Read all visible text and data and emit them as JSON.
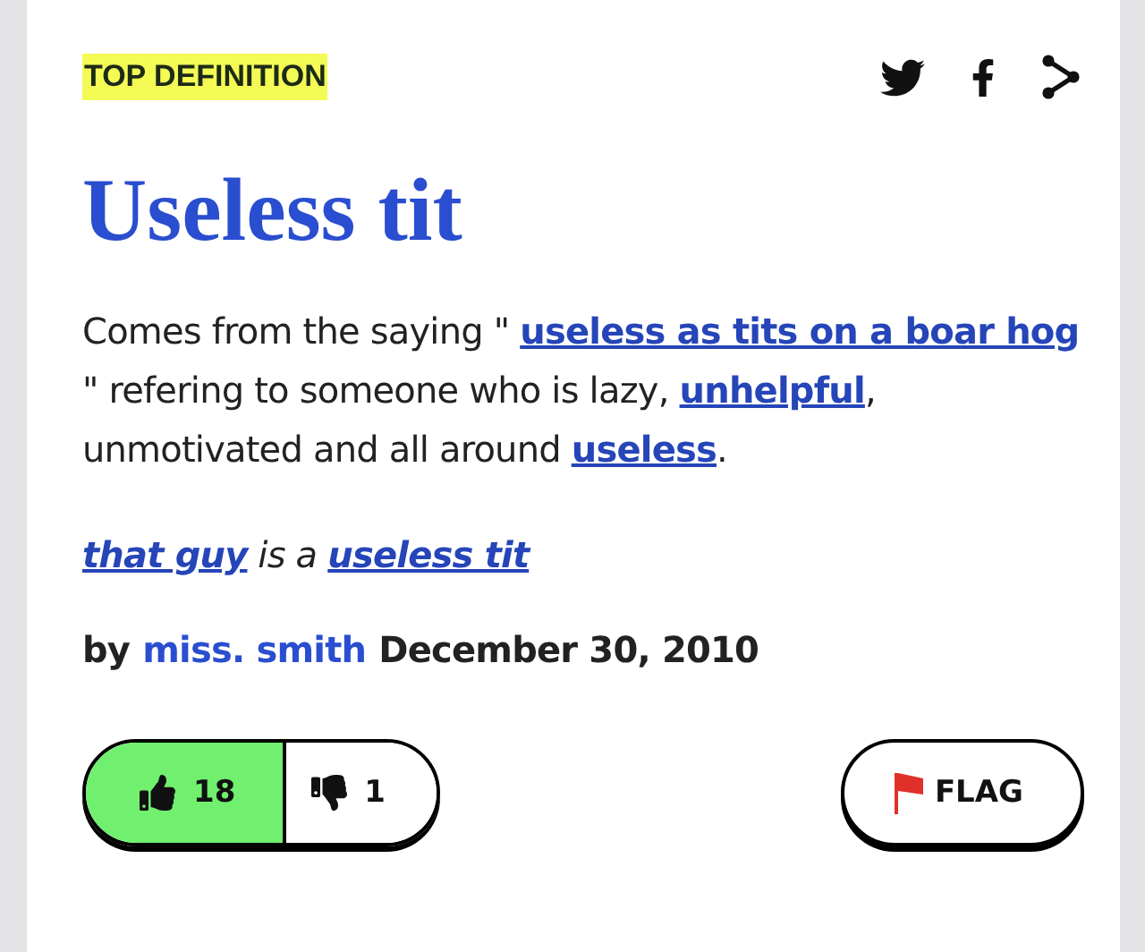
{
  "badge": "TOP DEFINITION",
  "title": "Useless tit",
  "meaning": [
    {
      "kind": "plain",
      "text": "Comes from the saying \" "
    },
    {
      "kind": "link",
      "text": "useless as tits on a boar hog"
    },
    {
      "kind": "plain",
      "text": " \" refering to someone who is lazy, "
    },
    {
      "kind": "link",
      "text": "unhelpful"
    },
    {
      "kind": "plain",
      "text": ", unmotivated and all around "
    },
    {
      "kind": "link",
      "text": "useless"
    },
    {
      "kind": "plain",
      "text": "."
    }
  ],
  "example": [
    {
      "kind": "link",
      "text": "that guy"
    },
    {
      "kind": "plain",
      "text": " is a "
    },
    {
      "kind": "link",
      "text": "useless tit"
    }
  ],
  "byline": {
    "prefix": "by",
    "author": "miss. smith",
    "date": "December 30, 2010"
  },
  "votes": [
    {
      "kind": "up",
      "count": "18",
      "selected": true
    },
    {
      "kind": "down",
      "count": "1",
      "selected": false
    }
  ],
  "flag": {
    "label": "FLAG"
  }
}
